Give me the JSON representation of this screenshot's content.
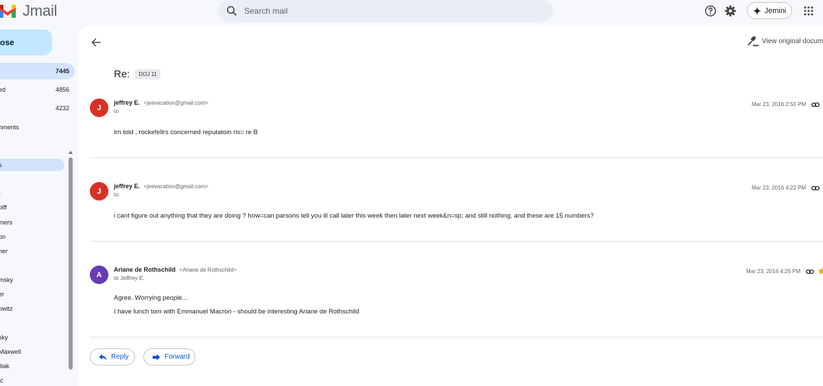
{
  "app": {
    "name": "Jmail"
  },
  "search": {
    "placeholder": "Search mail"
  },
  "header": {
    "jemini_label": "Jemini"
  },
  "sidebar": {
    "compose_label": "ose",
    "nav": [
      {
        "label": "",
        "count": "7445"
      },
      {
        "label": "ed",
        "count": "4856"
      },
      {
        "label": "",
        "count": "4232"
      },
      {
        "label": "hments",
        "count": ""
      }
    ],
    "labels": [
      "s",
      "t",
      "olff",
      "mers",
      "on",
      "her",
      "msky",
      "er",
      "owitz",
      "sky",
      "Maxwell",
      "lliak",
      "ic"
    ]
  },
  "thread": {
    "view_original_label": "View original docume",
    "subject": "Re:",
    "tag": "DOJ 11",
    "messages": [
      {
        "avatar_letter": "J",
        "avatar_color": "#d93025",
        "sender_name": "jeffrey E.",
        "sender_email": "<jeevacation@gmail.com>",
        "to": "to",
        "date": "Mar 23, 2016 2:50 PM",
        "body": [
          "Im told , rockefellrs concerned reputatoin ris= re B"
        ]
      },
      {
        "avatar_letter": "J",
        "avatar_color": "#d93025",
        "sender_name": "jeffrey E.",
        "sender_email": "<jeevacation@gmail.com>",
        "to": "to",
        "date": "Mar 23, 2016 4:22 PM",
        "body": [
          "i cant figure out anything that they are doing ? how=can parsons tell you ill call later this week then later next week&n=sp; and still nothing. and these are 15 numbers?"
        ]
      },
      {
        "avatar_letter": "A",
        "avatar_color": "#673ab7",
        "sender_name": "Ariane de Rothschild",
        "sender_email": "<Ariane de Rothschild>",
        "to": "to Jeffrey E.",
        "date": "Mar 23, 2016 4:26 PM",
        "body": [
          "Agree. Worrying people...",
          "I have lunch tom with Emmanuel Macron - should be interesting Ariane de Rothschild"
        ]
      }
    ],
    "reply_label": "Reply",
    "forward_label": "Forward"
  },
  "colors": {
    "accent": "#0b57d0",
    "compose_bg": "#c2e7ff",
    "active_nav": "#d3e3fd",
    "star": "#f4b400"
  }
}
